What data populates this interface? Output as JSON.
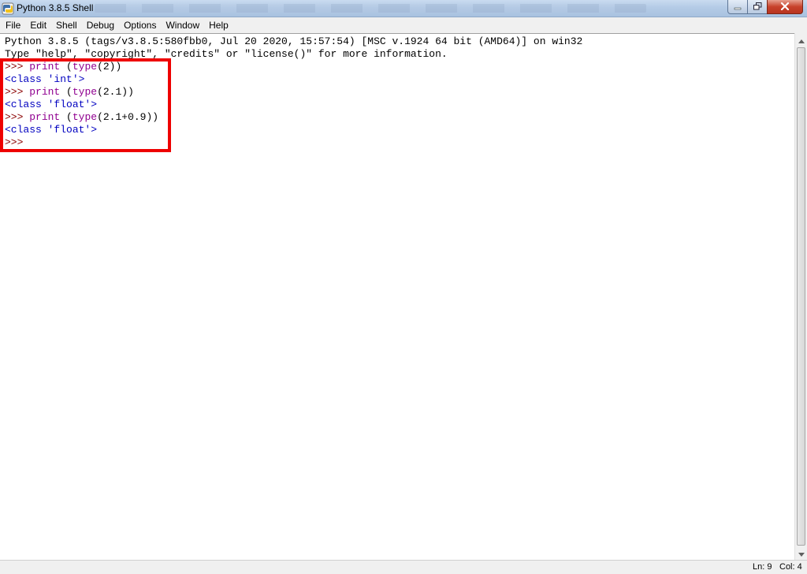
{
  "window": {
    "title": "Python 3.8.5 Shell"
  },
  "menu": {
    "items": [
      "File",
      "Edit",
      "Shell",
      "Debug",
      "Options",
      "Window",
      "Help"
    ]
  },
  "shell": {
    "banner_line1": "Python 3.8.5 (tags/v3.8.5:580fbb0, Jul 20 2020, 15:57:54) [MSC v.1924 64 bit (AMD64)] on win32",
    "banner_line2": "Type \"help\", \"copyright\", \"credits\" or \"license()\" for more information.",
    "entries": [
      {
        "prompt": ">>> ",
        "keyword": "print",
        "rest_pre": " (",
        "func": "type",
        "rest_post": "(2))"
      },
      {
        "output": "<class 'int'>"
      },
      {
        "prompt": ">>> ",
        "keyword": "print",
        "rest_pre": " (",
        "func": "type",
        "rest_post": "(2.1))"
      },
      {
        "output": "<class 'float'>"
      },
      {
        "prompt": ">>> ",
        "keyword": "print",
        "rest_pre": " (",
        "func": "type",
        "rest_post": "(2.1+0.9))"
      },
      {
        "output": "<class 'float'>"
      },
      {
        "prompt": ">>> "
      }
    ]
  },
  "status": {
    "ln": "Ln: 9",
    "col": "Col: 4"
  },
  "colors": {
    "highlight_box": "#ee0000",
    "prompt": "#8b0000",
    "keyword": "#900090",
    "output": "#0000c0"
  },
  "icons": {
    "app": "python-idle-icon",
    "minimize": "minimize-icon",
    "maximize": "restore-icon",
    "close": "close-icon",
    "scroll_up": "chevron-up-icon",
    "scroll_down": "chevron-down-icon"
  }
}
